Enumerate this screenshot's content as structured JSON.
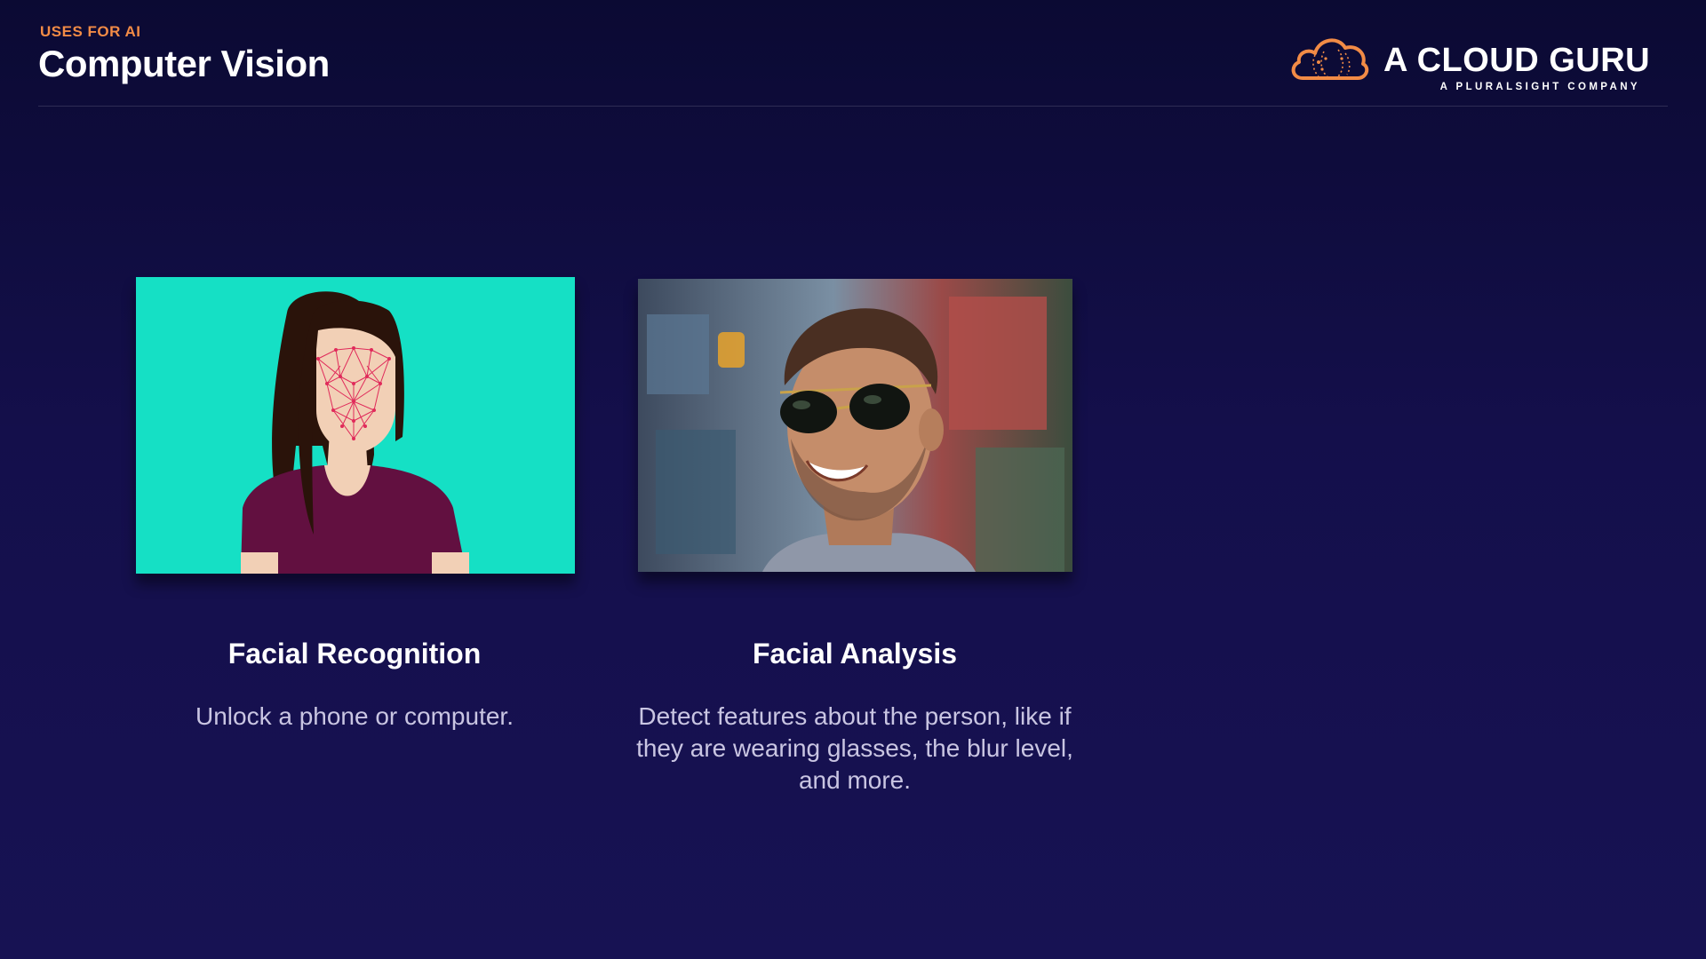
{
  "header": {
    "eyebrow": "USES FOR AI",
    "title": "Computer Vision"
  },
  "brand": {
    "name": "A CLOUD GURU",
    "tagline": "A PLURALSIGHT COMPANY",
    "icon": "cloud-logo-icon",
    "accent_color": "#f28b46"
  },
  "cards": [
    {
      "image": "face-mesh-illustration",
      "title": "Facial Recognition",
      "description": "Unlock a phone or computer."
    },
    {
      "image": "smiling-man-sunglasses-photo",
      "title": "Facial Analysis",
      "description": "Detect features about the person, like if they are wearing glasses, the blur level, and more."
    }
  ],
  "colors": {
    "background": "#140f4b",
    "illustration_bg": "#15e0c5",
    "shirt": "#621040",
    "hair": "#2a130a",
    "skin": "#f2d0b6",
    "mesh": "#e02a5a"
  }
}
